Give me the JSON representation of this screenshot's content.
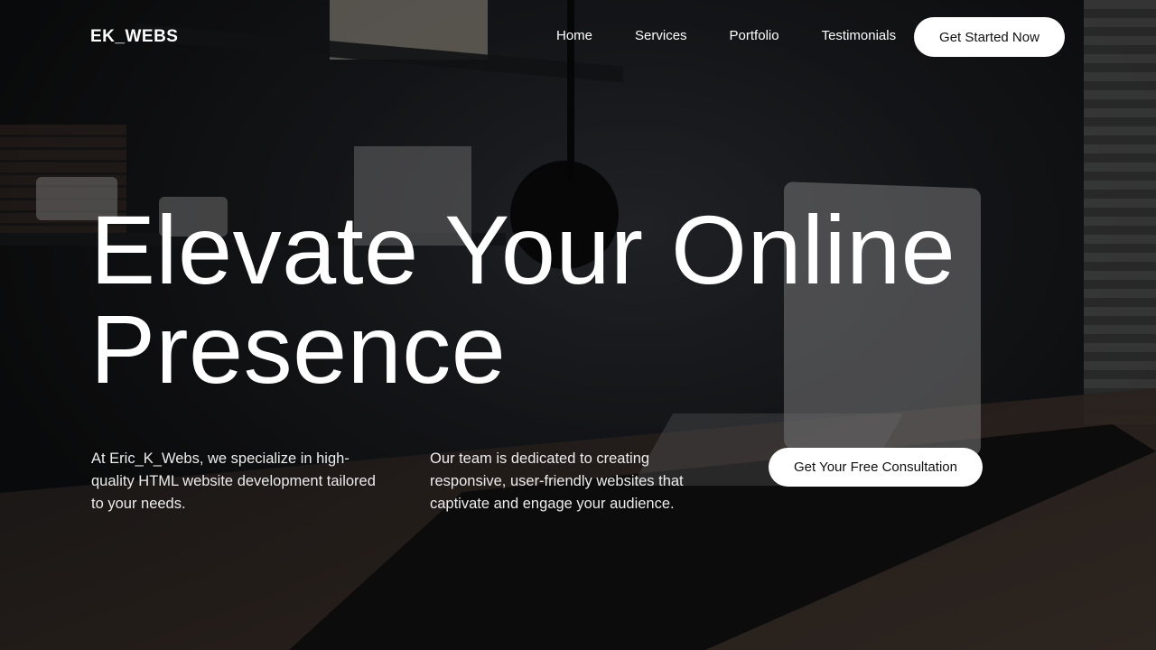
{
  "header": {
    "logo": "EK_WEBS",
    "nav": [
      {
        "label": "Home"
      },
      {
        "label": "Services"
      },
      {
        "label": "Portfolio"
      },
      {
        "label": "Testimonials"
      }
    ],
    "cta_label": "Get Started Now"
  },
  "hero": {
    "headline": "Elevate Your Online Presence",
    "description_left": "At Eric_K_Webs, we specialize in high-quality HTML website development tailored to your needs.",
    "description_right": "Our team is dedicated to creating responsive, user-friendly websites that captivate and engage your audience.",
    "cta_label": "Get Your Free Consultation"
  },
  "colors": {
    "button_bg": "#ffffff",
    "button_text": "#111111",
    "text": "#ffffff"
  }
}
